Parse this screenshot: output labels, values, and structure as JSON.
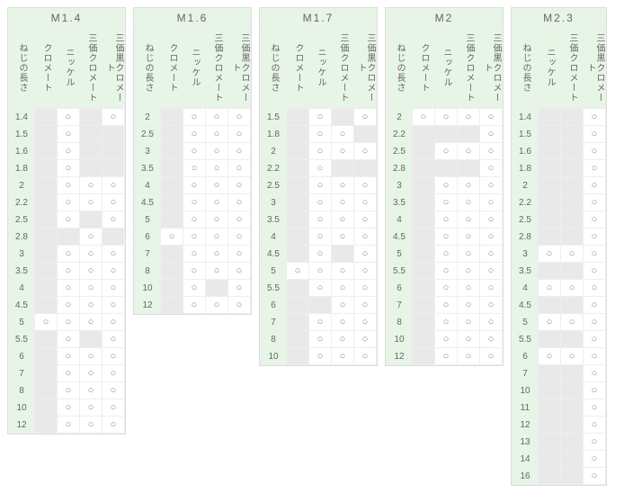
{
  "glyph_yes": "○",
  "rowhdr": "ねじの長さ",
  "tables": [
    {
      "title": "M1.4",
      "cols": [
        "クロメート",
        "ニッケル",
        "三価クロメート",
        "三価黒クロメート"
      ],
      "rows": [
        {
          "len": "1.4",
          "v": [
            0,
            1,
            0,
            1
          ]
        },
        {
          "len": "1.5",
          "v": [
            0,
            1,
            0,
            0
          ]
        },
        {
          "len": "1.6",
          "v": [
            0,
            1,
            0,
            0
          ]
        },
        {
          "len": "1.8",
          "v": [
            0,
            1,
            0,
            0
          ]
        },
        {
          "len": "2",
          "v": [
            0,
            1,
            1,
            1
          ]
        },
        {
          "len": "2.2",
          "v": [
            0,
            1,
            1,
            1
          ]
        },
        {
          "len": "2.5",
          "v": [
            0,
            1,
            0,
            1
          ]
        },
        {
          "len": "2.8",
          "v": [
            0,
            0,
            1,
            0
          ]
        },
        {
          "len": "3",
          "v": [
            0,
            1,
            1,
            1
          ]
        },
        {
          "len": "3.5",
          "v": [
            0,
            1,
            1,
            1
          ]
        },
        {
          "len": "4",
          "v": [
            0,
            1,
            1,
            1
          ]
        },
        {
          "len": "4.5",
          "v": [
            0,
            1,
            1,
            1
          ]
        },
        {
          "len": "5",
          "v": [
            1,
            1,
            1,
            1
          ]
        },
        {
          "len": "5.5",
          "v": [
            0,
            1,
            0,
            1
          ]
        },
        {
          "len": "6",
          "v": [
            0,
            1,
            1,
            1
          ]
        },
        {
          "len": "7",
          "v": [
            0,
            1,
            1,
            1
          ]
        },
        {
          "len": "8",
          "v": [
            0,
            1,
            1,
            1
          ]
        },
        {
          "len": "10",
          "v": [
            0,
            1,
            1,
            1
          ]
        },
        {
          "len": "12",
          "v": [
            0,
            1,
            1,
            1
          ]
        }
      ]
    },
    {
      "title": "M1.6",
      "cols": [
        "クロメート",
        "ニッケル",
        "三価クロメート",
        "三価黒クロメート"
      ],
      "rows": [
        {
          "len": "2",
          "v": [
            0,
            1,
            1,
            1
          ]
        },
        {
          "len": "2.5",
          "v": [
            0,
            1,
            1,
            1
          ]
        },
        {
          "len": "3",
          "v": [
            0,
            1,
            1,
            1
          ]
        },
        {
          "len": "3.5",
          "v": [
            0,
            1,
            1,
            1
          ]
        },
        {
          "len": "4",
          "v": [
            0,
            1,
            1,
            1
          ]
        },
        {
          "len": "4.5",
          "v": [
            0,
            1,
            1,
            1
          ]
        },
        {
          "len": "5",
          "v": [
            0,
            1,
            1,
            1
          ]
        },
        {
          "len": "6",
          "v": [
            1,
            1,
            1,
            1
          ]
        },
        {
          "len": "7",
          "v": [
            0,
            1,
            1,
            1
          ]
        },
        {
          "len": "8",
          "v": [
            0,
            1,
            1,
            1
          ]
        },
        {
          "len": "10",
          "v": [
            0,
            1,
            0,
            1
          ]
        },
        {
          "len": "12",
          "v": [
            0,
            1,
            1,
            1
          ]
        }
      ]
    },
    {
      "title": "M1.7",
      "cols": [
        "クロメート",
        "ニッケル",
        "三価クロメート",
        "三価黒クロメート"
      ],
      "rows": [
        {
          "len": "1.5",
          "v": [
            0,
            1,
            0,
            1
          ]
        },
        {
          "len": "1.8",
          "v": [
            0,
            1,
            1,
            0
          ]
        },
        {
          "len": "2",
          "v": [
            0,
            1,
            1,
            1
          ]
        },
        {
          "len": "2.2",
          "v": [
            0,
            1,
            0,
            0
          ]
        },
        {
          "len": "2.5",
          "v": [
            0,
            1,
            1,
            1
          ]
        },
        {
          "len": "3",
          "v": [
            0,
            1,
            1,
            1
          ]
        },
        {
          "len": "3.5",
          "v": [
            0,
            1,
            1,
            1
          ]
        },
        {
          "len": "4",
          "v": [
            0,
            1,
            1,
            1
          ]
        },
        {
          "len": "4.5",
          "v": [
            0,
            1,
            0,
            1
          ]
        },
        {
          "len": "5",
          "v": [
            1,
            1,
            1,
            1
          ]
        },
        {
          "len": "5.5",
          "v": [
            0,
            1,
            1,
            1
          ]
        },
        {
          "len": "6",
          "v": [
            0,
            0,
            1,
            1
          ]
        },
        {
          "len": "7",
          "v": [
            0,
            1,
            1,
            1
          ]
        },
        {
          "len": "8",
          "v": [
            0,
            1,
            1,
            1
          ]
        },
        {
          "len": "10",
          "v": [
            0,
            1,
            1,
            1
          ]
        }
      ]
    },
    {
      "title": "M2",
      "cols": [
        "クロメート",
        "ニッケル",
        "三価クロメート",
        "三価黒クロメート"
      ],
      "rows": [
        {
          "len": "2",
          "v": [
            1,
            1,
            1,
            1
          ]
        },
        {
          "len": "2.2",
          "v": [
            0,
            0,
            0,
            1
          ]
        },
        {
          "len": "2.5",
          "v": [
            0,
            1,
            1,
            1
          ]
        },
        {
          "len": "2.8",
          "v": [
            0,
            0,
            0,
            1
          ]
        },
        {
          "len": "3",
          "v": [
            0,
            1,
            1,
            1
          ]
        },
        {
          "len": "3.5",
          "v": [
            0,
            1,
            1,
            1
          ]
        },
        {
          "len": "4",
          "v": [
            0,
            1,
            1,
            1
          ]
        },
        {
          "len": "4.5",
          "v": [
            0,
            1,
            1,
            1
          ]
        },
        {
          "len": "5",
          "v": [
            0,
            1,
            1,
            1
          ]
        },
        {
          "len": "5.5",
          "v": [
            0,
            1,
            1,
            1
          ]
        },
        {
          "len": "6",
          "v": [
            0,
            1,
            1,
            1
          ]
        },
        {
          "len": "7",
          "v": [
            0,
            1,
            1,
            1
          ]
        },
        {
          "len": "8",
          "v": [
            0,
            1,
            1,
            1
          ]
        },
        {
          "len": "10",
          "v": [
            0,
            1,
            1,
            1
          ]
        },
        {
          "len": "12",
          "v": [
            0,
            1,
            1,
            1
          ]
        }
      ]
    },
    {
      "title": "M2.3",
      "cols": [
        "ニッケル",
        "三価クロメート",
        "三価黒クロメート"
      ],
      "rows": [
        {
          "len": "1.4",
          "v": [
            0,
            0,
            1
          ]
        },
        {
          "len": "1.5",
          "v": [
            0,
            0,
            1
          ]
        },
        {
          "len": "1.6",
          "v": [
            0,
            0,
            1
          ]
        },
        {
          "len": "1.8",
          "v": [
            0,
            0,
            1
          ]
        },
        {
          "len": "2",
          "v": [
            0,
            0,
            1
          ]
        },
        {
          "len": "2.2",
          "v": [
            0,
            0,
            1
          ]
        },
        {
          "len": "2.5",
          "v": [
            0,
            0,
            1
          ]
        },
        {
          "len": "2.8",
          "v": [
            0,
            0,
            1
          ]
        },
        {
          "len": "3",
          "v": [
            1,
            1,
            1
          ]
        },
        {
          "len": "3.5",
          "v": [
            0,
            0,
            1
          ]
        },
        {
          "len": "4",
          "v": [
            1,
            1,
            1
          ]
        },
        {
          "len": "4.5",
          "v": [
            0,
            0,
            1
          ]
        },
        {
          "len": "5",
          "v": [
            1,
            1,
            1
          ]
        },
        {
          "len": "5.5",
          "v": [
            0,
            0,
            1
          ]
        },
        {
          "len": "6",
          "v": [
            1,
            1,
            1
          ]
        },
        {
          "len": "7",
          "v": [
            0,
            0,
            1
          ]
        },
        {
          "len": "10",
          "v": [
            0,
            0,
            1
          ]
        },
        {
          "len": "11",
          "v": [
            0,
            0,
            1
          ]
        },
        {
          "len": "12",
          "v": [
            0,
            0,
            1
          ]
        },
        {
          "len": "13",
          "v": [
            0,
            0,
            1
          ]
        },
        {
          "len": "14",
          "v": [
            0,
            0,
            1
          ]
        },
        {
          "len": "16",
          "v": [
            0,
            0,
            1
          ]
        }
      ]
    }
  ]
}
